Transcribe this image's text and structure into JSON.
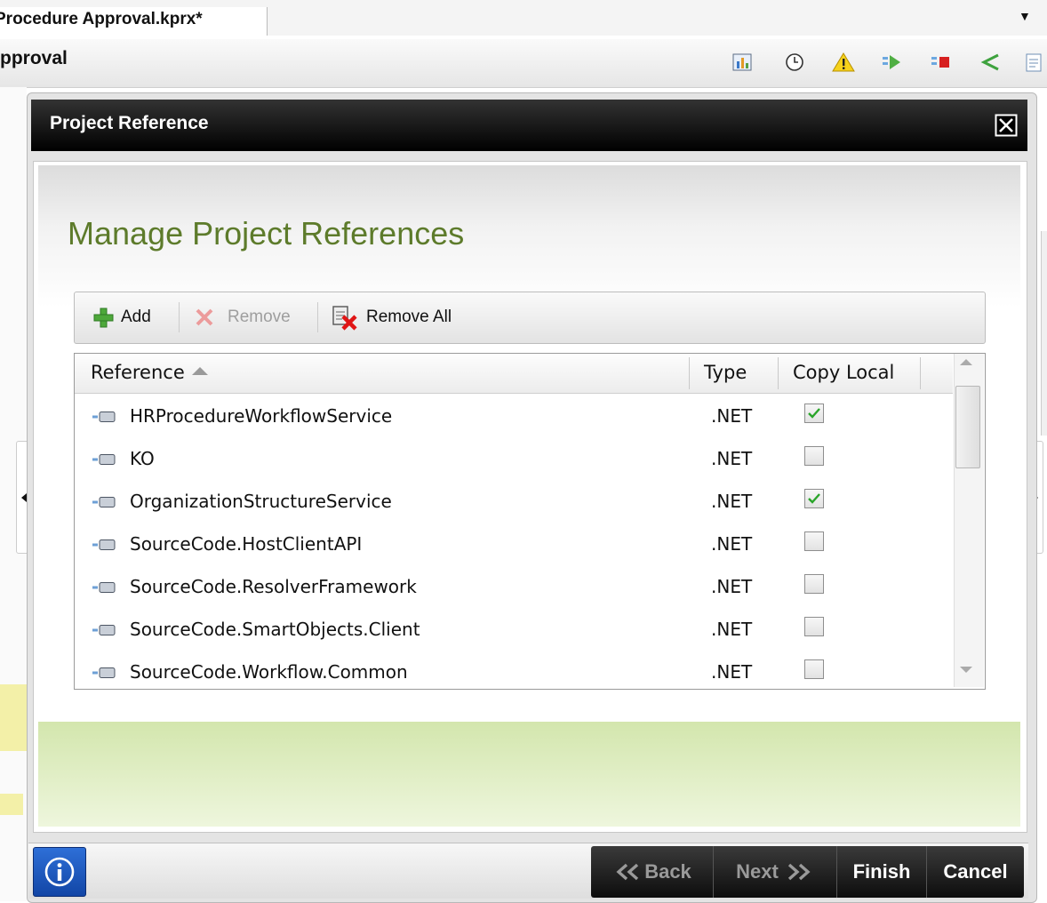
{
  "window": {
    "tab_title": "Procedure Approval.kprx*",
    "tab_dropdown_glyph": "▼",
    "subtitle": "pproval",
    "toolbar_icons": [
      "chart-icon",
      "clock-icon",
      "warning-icon",
      "play-arrow-icon",
      "stop-arrow-icon",
      "share-icon",
      "document-icon"
    ]
  },
  "dialog": {
    "title": "Project Reference",
    "heading": "Manage Project References",
    "toolbar": {
      "add_label": "Add",
      "remove_label": "Remove",
      "remove_all_label": "Remove All"
    },
    "grid": {
      "columns": [
        "Reference",
        "Type",
        "Copy Local"
      ],
      "sort_column": "Reference",
      "sort_direction": "ascending",
      "rows": [
        {
          "name": "HRProcedureWorkflowService",
          "type": ".NET",
          "copy_local": true
        },
        {
          "name": "KO",
          "type": ".NET",
          "copy_local": false
        },
        {
          "name": "OrganizationStructureService",
          "type": ".NET",
          "copy_local": true
        },
        {
          "name": "SourceCode.HostClientAPI",
          "type": ".NET",
          "copy_local": false
        },
        {
          "name": "SourceCode.ResolverFramework",
          "type": ".NET",
          "copy_local": false
        },
        {
          "name": "SourceCode.SmartObjects.Client",
          "type": ".NET",
          "copy_local": false
        },
        {
          "name": "SourceCode.Workflow.Common",
          "type": ".NET",
          "copy_local": false
        }
      ]
    },
    "footer": {
      "back_label": "Back",
      "next_label": "Next",
      "finish_label": "Finish",
      "cancel_label": "Cancel"
    }
  },
  "colors": {
    "heading": "#5d7b2b",
    "header_bar": "#000000",
    "green_band": "#d3e6ad",
    "check_mark": "#2aa52a",
    "info_button": "#1c57c2"
  }
}
